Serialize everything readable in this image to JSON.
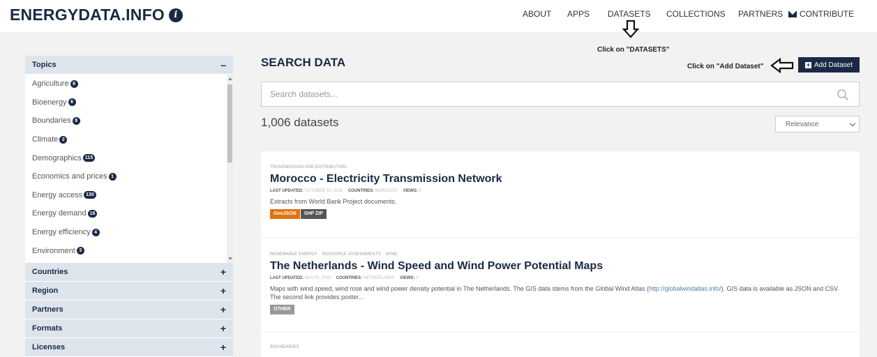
{
  "header": {
    "logo": "ENERGYDATA.INFO",
    "nav": {
      "about": "ABOUT",
      "apps": "APPS",
      "datasets": "DATASETS",
      "collections": "COLLECTIONS",
      "partners": "PARTNERS",
      "contribute": "CONTRIBUTE"
    }
  },
  "annotations": {
    "datasets": "Click on \"DATASETS\"",
    "add_dataset": "Click on \"Add Dataset\""
  },
  "sidebar": {
    "topics": {
      "label": "Topics",
      "items": [
        {
          "label": "Agriculture",
          "count": "8"
        },
        {
          "label": "Bioenergy",
          "count": "6"
        },
        {
          "label": "Boundaries",
          "count": "8"
        },
        {
          "label": "Climate",
          "count": "2"
        },
        {
          "label": "Demographics",
          "count": "115"
        },
        {
          "label": "Economics and prices",
          "count": "1"
        },
        {
          "label": "Energy access",
          "count": "130"
        },
        {
          "label": "Energy demand",
          "count": "16"
        },
        {
          "label": "Energy efficiency",
          "count": "4"
        },
        {
          "label": "Environment",
          "count": "3"
        }
      ]
    },
    "facets": [
      "Countries",
      "Region",
      "Partners",
      "Formats",
      "Licenses"
    ]
  },
  "main": {
    "title": "SEARCH DATA",
    "add_dataset": "Add Dataset",
    "search_placeholder": "Search datasets...",
    "count": "1,006 datasets",
    "sort": "Relevance"
  },
  "results": [
    {
      "tags": [
        "TRANSMISSION AND DISTRIBUTION"
      ],
      "title": "Morocco - Electricity Transmission Network",
      "meta": {
        "updated_label": "LAST UPDATED:",
        "updated": "OCTOBER 22, 2019",
        "countries_label": "COUNTRIES:",
        "countries": "MOROCCO",
        "views_label": "VIEWS:",
        "views": "0"
      },
      "description": "Extracts from World Bank Project documents.",
      "formats": [
        {
          "label": "GeoJSON",
          "color": "#e0730e"
        },
        {
          "label": "SHP ZIP",
          "color": "#555555"
        }
      ]
    },
    {
      "tags": [
        "RENEWABLE ENERGY",
        "RESOURCE ASSESSMENTS",
        "WIND"
      ],
      "title": "The Netherlands - Wind Speed and Wind Power Potential Maps",
      "meta": {
        "updated_label": "LAST UPDATED:",
        "updated": "MAY 31, 2019",
        "countries_label": "COUNTRIES:",
        "countries": "NETHERLANDS",
        "views_label": "VIEWS:",
        "views": "0"
      },
      "description_pre": "Maps with wind speed, wind rose and wind power density potential in The Netherlands. The GIS data stems from the Global Wind Atlas (",
      "description_link": "http://globalwindatlas.info/",
      "description_post": "). GIS data is available as JSON and CSV. The second link provides poster...",
      "formats": [
        {
          "label": "OTHER",
          "color": "#999999"
        }
      ]
    },
    {
      "tags": [
        "BOUNDARIES"
      ]
    }
  ]
}
